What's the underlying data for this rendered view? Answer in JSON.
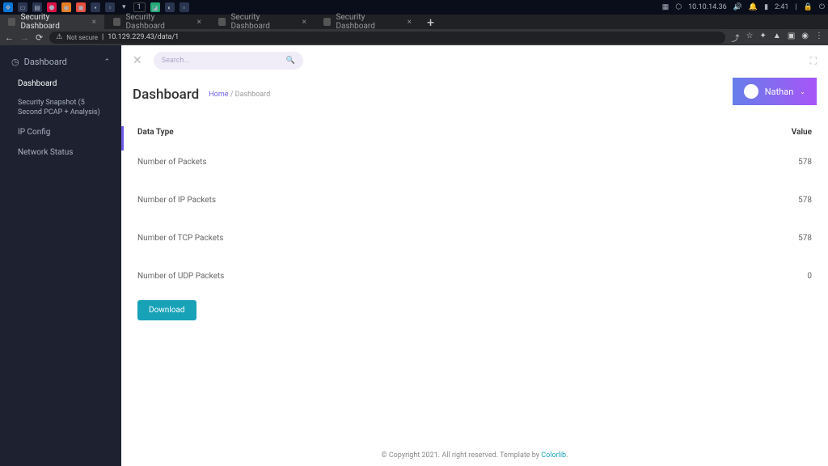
{
  "os": {
    "ip": "10.10.14.36",
    "time": "2:41",
    "workspace": "1"
  },
  "browser": {
    "tabs": [
      {
        "title": "Security Dashboard",
        "active": true
      },
      {
        "title": "Security Dashboard",
        "active": false
      },
      {
        "title": "Security Dashboard",
        "active": false
      },
      {
        "title": "Security Dashboard",
        "active": false
      }
    ],
    "url_warning": "Not secure",
    "url": "10.129.229.43/data/1"
  },
  "sidebar": {
    "header": "Dashboard",
    "items": [
      {
        "label": "Dashboard",
        "active": true
      },
      {
        "label": "Security Snapshot (5 Second PCAP + Analysis)",
        "long": true
      },
      {
        "label": "IP Config"
      },
      {
        "label": "Network Status"
      }
    ]
  },
  "top": {
    "search_placeholder": "Search..."
  },
  "header": {
    "title": "Dashboard",
    "breadcrumb_home": "Home",
    "breadcrumb_sep": "/",
    "breadcrumb_current": "Dashboard",
    "user": "Nathan"
  },
  "table": {
    "col_type": "Data Type",
    "col_value": "Value",
    "rows": [
      {
        "type": "Number of Packets",
        "value": "578"
      },
      {
        "type": "Number of IP Packets",
        "value": "578"
      },
      {
        "type": "Number of TCP Packets",
        "value": "578"
      },
      {
        "type": "Number of UDP Packets",
        "value": "0"
      }
    ],
    "download": "Download"
  },
  "footer": {
    "text": "© Copyright 2021. All right reserved. Template by ",
    "link": "Colorlib"
  }
}
